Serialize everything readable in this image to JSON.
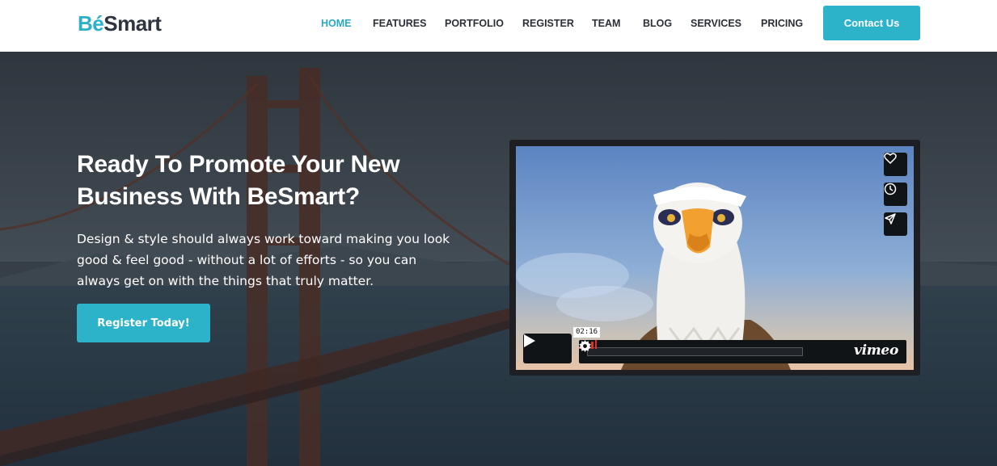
{
  "brand": {
    "accent": "Bé",
    "rest": "Smart",
    "accent_color": "#2bb0c9"
  },
  "nav": {
    "items": [
      {
        "label": "HOME",
        "active": true
      },
      {
        "label": "FEATURES",
        "active": false
      },
      {
        "label": "PORTFOLIO",
        "active": false
      },
      {
        "label": "REGISTER",
        "active": false
      },
      {
        "label": "TEAM",
        "active": false
      },
      {
        "label": "BLOG",
        "active": false
      },
      {
        "label": "SERVICES",
        "active": false
      },
      {
        "label": "PRICING",
        "active": false
      }
    ],
    "contact_label": "Contact Us"
  },
  "hero": {
    "title_line1": "Ready To Promote Your New",
    "title_line2": "Business With BeSmart?",
    "text": "Design & style should always work toward making you look good & feel good - without a lot of efforts - so you can always get on with the things that truly matter.",
    "register_label": "Register Today!"
  },
  "video": {
    "time": "02:16",
    "player_brand": "vimeo",
    "side_buttons": [
      "heart-icon",
      "clock-icon",
      "send-icon"
    ]
  },
  "colors": {
    "primary": "#2cb3c9",
    "nav_text": "#2b2f36",
    "nav_active": "#2aa8c4"
  }
}
